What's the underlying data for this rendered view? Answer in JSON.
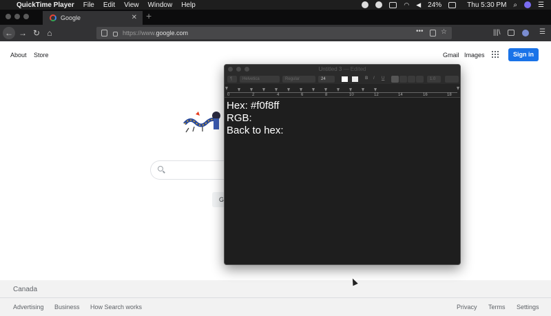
{
  "menubar": {
    "app_name": "QuickTime Player",
    "items": [
      "File",
      "Edit",
      "View",
      "Window",
      "Help"
    ],
    "battery": "24%",
    "clock": "Thu 5:30 PM"
  },
  "browser": {
    "tab_title": "Google",
    "url_protocol": "https://www.",
    "url_domain": "google.com"
  },
  "google": {
    "links_left": [
      "About",
      "Store"
    ],
    "links_right": [
      "Gmail",
      "Images"
    ],
    "sign_in": "Sign in",
    "button_partial": "G"
  },
  "footer": {
    "country": "Canada",
    "left_links": [
      "Advertising",
      "Business",
      "How Search works"
    ],
    "right_links": [
      "Privacy",
      "Terms",
      "Settings"
    ]
  },
  "textedit": {
    "title": "Untitled 3",
    "edited": "— Edited",
    "font_family": "Helvetica",
    "font_style": "Regular",
    "font_size": "24",
    "line_spacing": "1.0",
    "ruler_numbers": [
      "0",
      "2",
      "4",
      "6",
      "8",
      "10",
      "12",
      "14",
      "16",
      "18"
    ],
    "lines": [
      "Hex: #f0f8ff",
      "RGB:",
      "Back to hex:"
    ]
  }
}
